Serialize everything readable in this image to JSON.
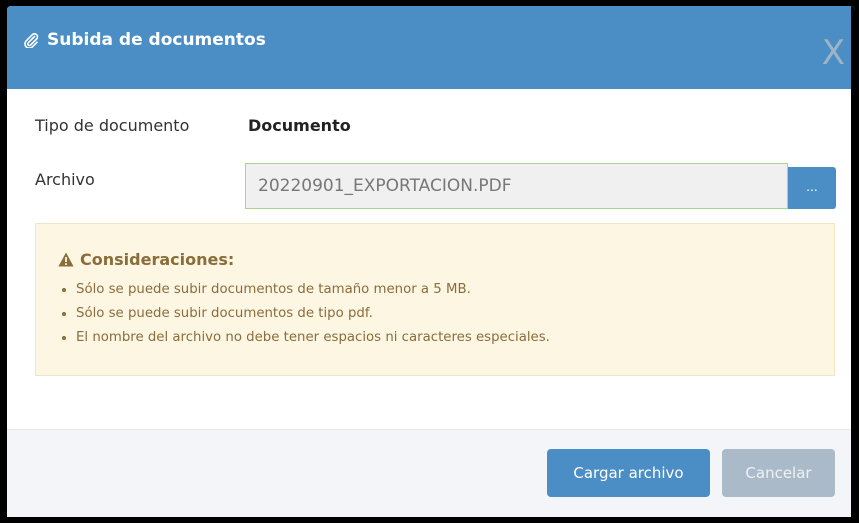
{
  "dialog": {
    "title": "Subida de documentos",
    "title_icon": "paperclip-icon",
    "close_label": "X"
  },
  "form": {
    "doc_type_label": "Tipo de documento",
    "doc_type_value": "Documento",
    "file_label": "Archivo",
    "file_value": "20220901_EXPORTACION.PDF",
    "browse_label": "..."
  },
  "notice": {
    "icon": "warning-icon",
    "title": "Consideraciones:",
    "items": [
      "Sólo se puede subir documentos de tamaño menor a 5 MB.",
      "Sólo se puede subir documentos de tipo pdf.",
      "El nombre del archivo no debe tener espacios ni caracteres especiales."
    ]
  },
  "footer": {
    "upload_label": "Cargar archivo",
    "cancel_label": "Cancelar"
  },
  "colors": {
    "header": "#4a8ec5",
    "notice_bg": "#fcf6e3",
    "notice_text": "#8a6d3b",
    "cancel_bg": "#abbac9"
  }
}
